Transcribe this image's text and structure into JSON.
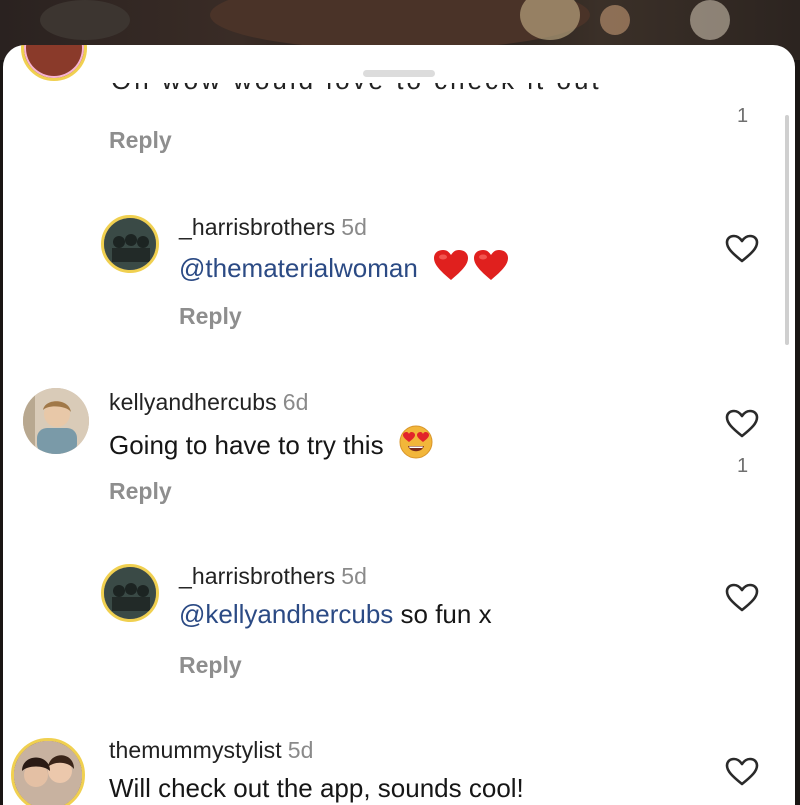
{
  "comments_sheet": {
    "top_partial": {
      "text": "Oh wow would love to check it out",
      "reply_label": "Reply",
      "like_count": "1"
    },
    "comments": [
      {
        "username": "_harrisbrothers",
        "age": "5d",
        "mention": "@thematerialwoman",
        "text": "",
        "emoji": "red-heart red-heart",
        "reply_label": "Reply",
        "like_count": ""
      },
      {
        "username": "kellyandhercubs",
        "age": "6d",
        "mention": "",
        "text": "Going to have to try this",
        "emoji": "heart-eyes-face",
        "reply_label": "Reply",
        "like_count": "1"
      },
      {
        "username": "_harrisbrothers",
        "age": "5d",
        "mention": "@kellyandhercubs",
        "text": " so fun x",
        "emoji": "",
        "reply_label": "Reply",
        "like_count": ""
      },
      {
        "username": "themummystylist",
        "age": "5d",
        "mention": "",
        "text": "Will check out the app, sounds cool!",
        "emoji": "",
        "reply_label": "",
        "like_count": ""
      }
    ]
  },
  "colors": {
    "mention": "#2b4a84",
    "avatar_ring": "#f0d050"
  }
}
